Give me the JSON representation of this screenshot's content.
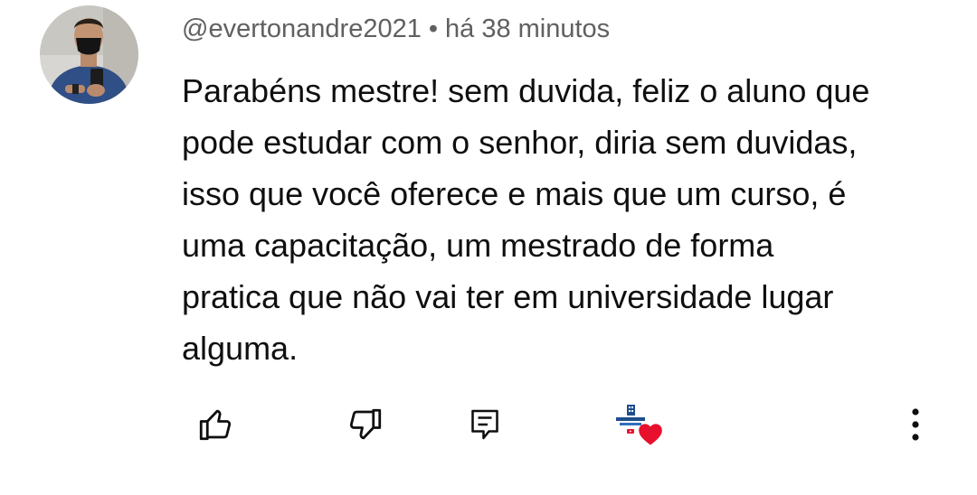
{
  "comment": {
    "author": "@evertonandre2021",
    "separator": "•",
    "time": "há 38 minutos",
    "text": "Parabéns mestre! sem duvida, feliz o aluno que\npode estudar com o senhor, diria sem duvidas,\nisso que você oferece e mais que um curso, é\numa capacitação, um mestrado de forma\npratica que não vai ter em universidade lugar\nalguma."
  },
  "actions": {
    "like_icon": "thumbs-up-icon",
    "dislike_icon": "thumbs-down-icon",
    "reply_icon": "comment-icon",
    "creator_heart_icon": "creator-heart-icon",
    "more_icon": "more-vertical-icon"
  },
  "colors": {
    "text": "#0f0f0f",
    "secondary": "#606060",
    "heart": "#e8112d",
    "background": "#ffffff"
  }
}
